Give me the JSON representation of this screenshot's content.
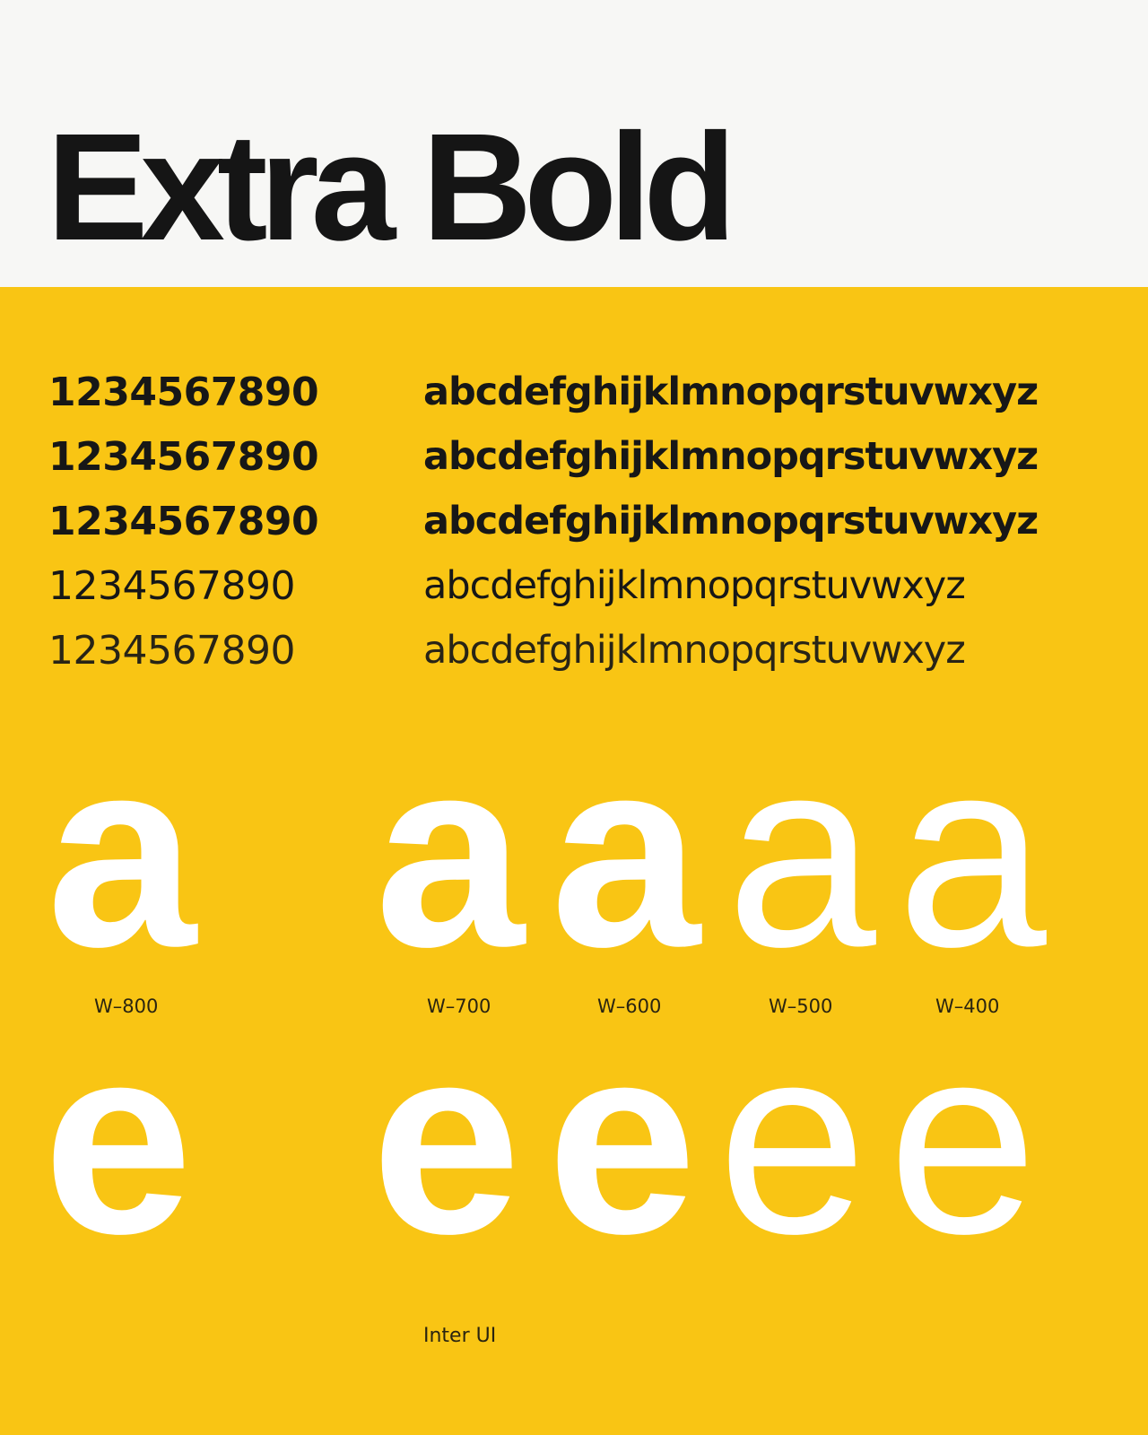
{
  "title": "Extra Bold",
  "specimen": {
    "digits": "1234567890",
    "alphabet": "abcdefghijklmnopqrstuvwxyz"
  },
  "glyph_a": "a",
  "glyph_e": "e",
  "weights": {
    "w800": "W–800",
    "w700": "W–700",
    "w600": "W–600",
    "w500": "W–500",
    "w400": "W–400"
  },
  "font_name": "Inter UI",
  "colors": {
    "background_top": "#f7f7f5",
    "panel": "#f9c514",
    "text": "#151515",
    "glyph": "#ffffff"
  }
}
